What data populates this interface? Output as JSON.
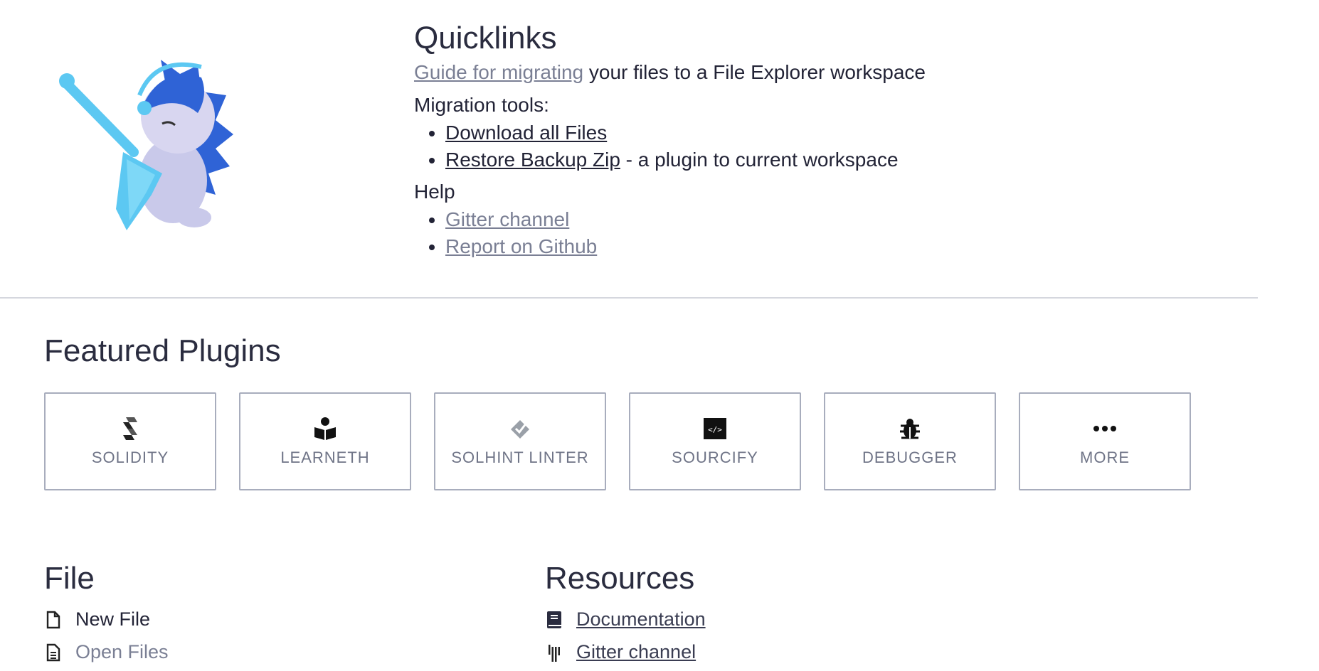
{
  "quicklinks": {
    "title": "Quicklinks",
    "guide_link": "Guide for migrating",
    "guide_rest": " your files to a File Explorer workspace",
    "migration_label": "Migration tools:",
    "migration_items": [
      {
        "link": "Download all Files",
        "rest": ""
      },
      {
        "link": "Restore Backup Zip",
        "rest": " - a plugin to current workspace"
      }
    ],
    "help_label": "Help",
    "help_items": [
      {
        "link": "Gitter channel"
      },
      {
        "link": "Report on Github"
      }
    ]
  },
  "featured": {
    "title": "Featured Plugins",
    "plugins": [
      {
        "label": "SOLIDITY",
        "icon": "solidity-icon"
      },
      {
        "label": "LEARNETH",
        "icon": "book-reader-icon"
      },
      {
        "label": "SOLHINT LINTER",
        "icon": "check-diamond-icon"
      },
      {
        "label": "SOURCIFY",
        "icon": "code-box-icon"
      },
      {
        "label": "DEBUGGER",
        "icon": "bug-icon"
      },
      {
        "label": "MORE",
        "icon": "ellipsis-icon"
      }
    ]
  },
  "file_section": {
    "title": "File",
    "items": [
      {
        "label": "New File",
        "icon": "file-icon"
      },
      {
        "label": "Open Files",
        "icon": "file-lines-icon"
      }
    ]
  },
  "resources": {
    "title": "Resources",
    "items": [
      {
        "label": "Documentation",
        "icon": "book-icon"
      },
      {
        "label": "Gitter channel",
        "icon": "gitter-icon"
      }
    ]
  },
  "colors": {
    "text": "#222336",
    "muted_link": "#7a7f94",
    "border": "#a8adbd",
    "mascot_blue": "#2f63d6",
    "mascot_light": "#5cc8f2"
  }
}
